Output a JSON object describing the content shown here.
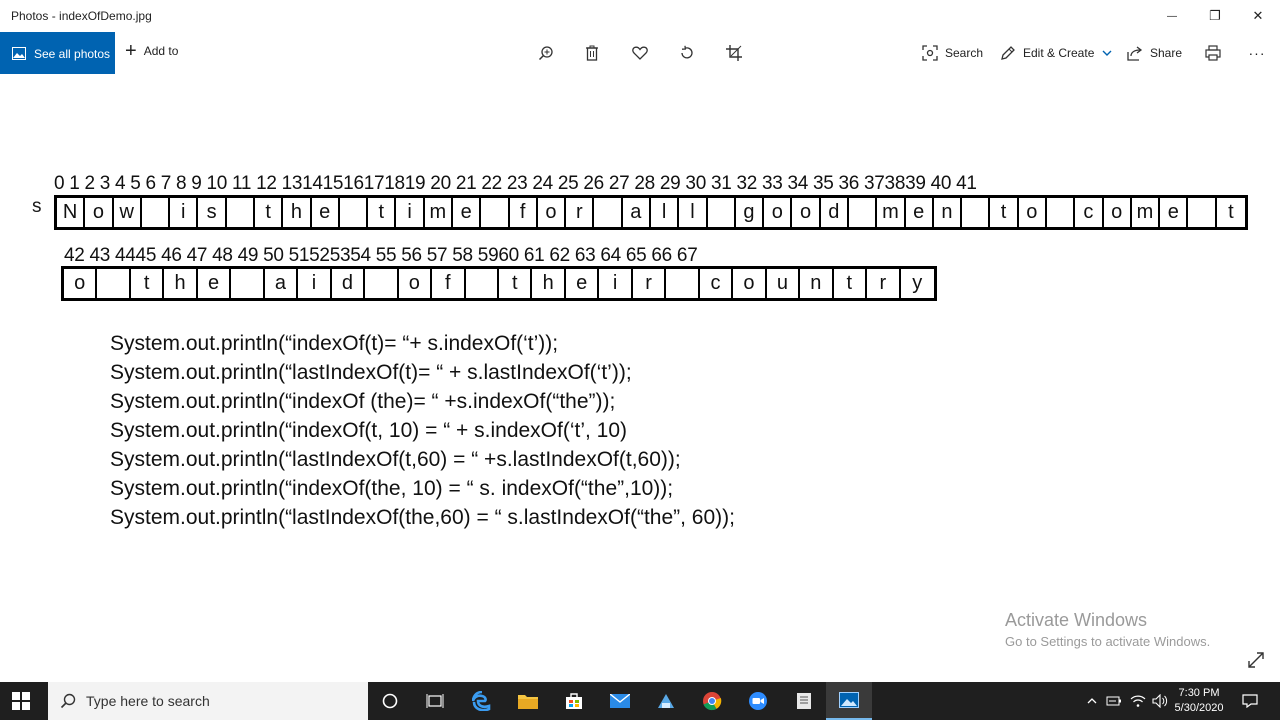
{
  "window": {
    "title": "Photos - indexOfDemo.jpg",
    "minimize_glyph": "—",
    "maximize_glyph": "❐",
    "close_glyph": "✕"
  },
  "toolbar": {
    "see_all_photos": "See all photos",
    "add_to": "Add to",
    "search": "Search",
    "edit_create": "Edit & Create",
    "share": "Share",
    "more_glyph": "···",
    "icons": [
      "zoom-icon",
      "delete-icon",
      "favorite-icon",
      "rotate-icon",
      "crop-icon",
      "print-icon"
    ]
  },
  "image": {
    "var_label": "s",
    "row1_indices": "0  1  2 3  4  5  6  7  8  9 10 11  12  13141516171819  20  21  22  23  24   25   26  27  28  29  30  31  32   33  34  35   36  373839  40  41",
    "row1_chars": [
      "N",
      "o",
      "w",
      "",
      "i",
      "s",
      "",
      "t",
      "h",
      "e",
      "",
      "t",
      "i",
      "m",
      "e",
      "",
      "f",
      "o",
      "r",
      "",
      "a",
      "l",
      "l",
      "",
      "g",
      "o",
      "o",
      "d",
      "",
      "m",
      "e",
      "n",
      "",
      "t",
      "o",
      "",
      "c",
      "o",
      "m",
      "e",
      "",
      "t"
    ],
    "row2_indices": "42  43  4445  46  47  48  49  50  51525354  55  56  57  58  5960 61  62  63   64  65  66   67",
    "row2_chars": [
      "o",
      "",
      "t",
      "h",
      "e",
      "",
      "a",
      "i",
      "d",
      "",
      "o",
      "f",
      "",
      "t",
      "h",
      "e",
      "i",
      "r",
      "",
      "c",
      "o",
      "u",
      "n",
      "t",
      "r",
      "y"
    ],
    "code_lines": [
      "System.out.println(“indexOf(t)= “+ s.indexOf(‘t’));",
      "System.out.println(“lastIndexOf(t)= “ + s.lastIndexOf(‘t’));",
      "System.out.println(“indexOf (the)= “ +s.indexOf(“the”));",
      "System.out.println(“indexOf(t, 10) = “ + s.indexOf(‘t’, 10)",
      "System.out.println(“lastIndexOf(t,60) = “ +s.lastIndexOf(t,60));",
      "System.out.println(“indexOf(the, 10) = “ s. indexOf(“the”,10));",
      "System.out.println(“lastIndexOf(the,60) = “ s.lastIndexOf(“the”, 60));"
    ]
  },
  "watermark": {
    "line1": "Activate Windows",
    "line2": "Go to Settings to activate Windows."
  },
  "taskbar": {
    "search_placeholder": "Type here to search",
    "time": "7:30 PM",
    "date": "5/30/2020"
  },
  "colors": {
    "accent": "#0063b1",
    "taskbar": "#1f1f1f"
  }
}
